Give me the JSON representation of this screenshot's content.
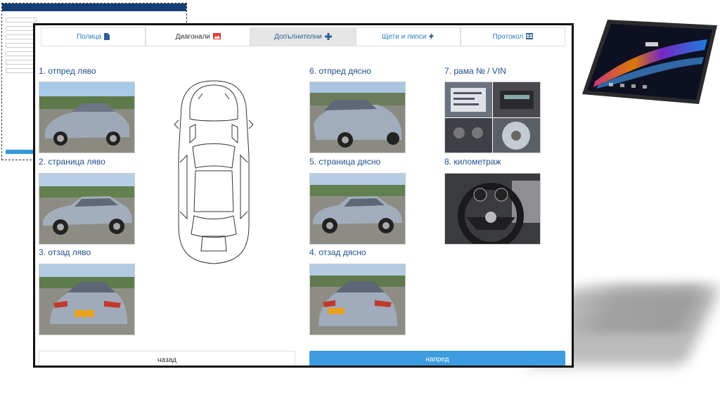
{
  "window": {
    "tabs": [
      {
        "label": "Полица",
        "icon": "file-icon"
      },
      {
        "label": "Диагонали",
        "icon": "image-icon"
      },
      {
        "label": "Допълнителни",
        "icon": "plus-icon"
      },
      {
        "label": "Щети и липси",
        "icon": "bolt-icon"
      },
      {
        "label": "Протокол",
        "icon": "table-icon"
      }
    ],
    "active_tab": "Диагонали"
  },
  "photos": [
    {
      "label": "1. отпред ляво"
    },
    {
      "label": "2. страница ляво"
    },
    {
      "label": "3. отзад ляво"
    },
    {
      "label": "6. отпред дясно"
    },
    {
      "label": "5. страница дясно"
    },
    {
      "label": "4. отзад дясно"
    },
    {
      "label": "7. рама № / VIN"
    },
    {
      "label": "8. километраж"
    }
  ],
  "buttons": {
    "back": "назад",
    "next": "напред"
  },
  "colors": {
    "accent": "#3d9be0",
    "heading": "#1f4e8c",
    "tab_link": "#2c7bbf",
    "car_body": "#9ea9b8"
  }
}
